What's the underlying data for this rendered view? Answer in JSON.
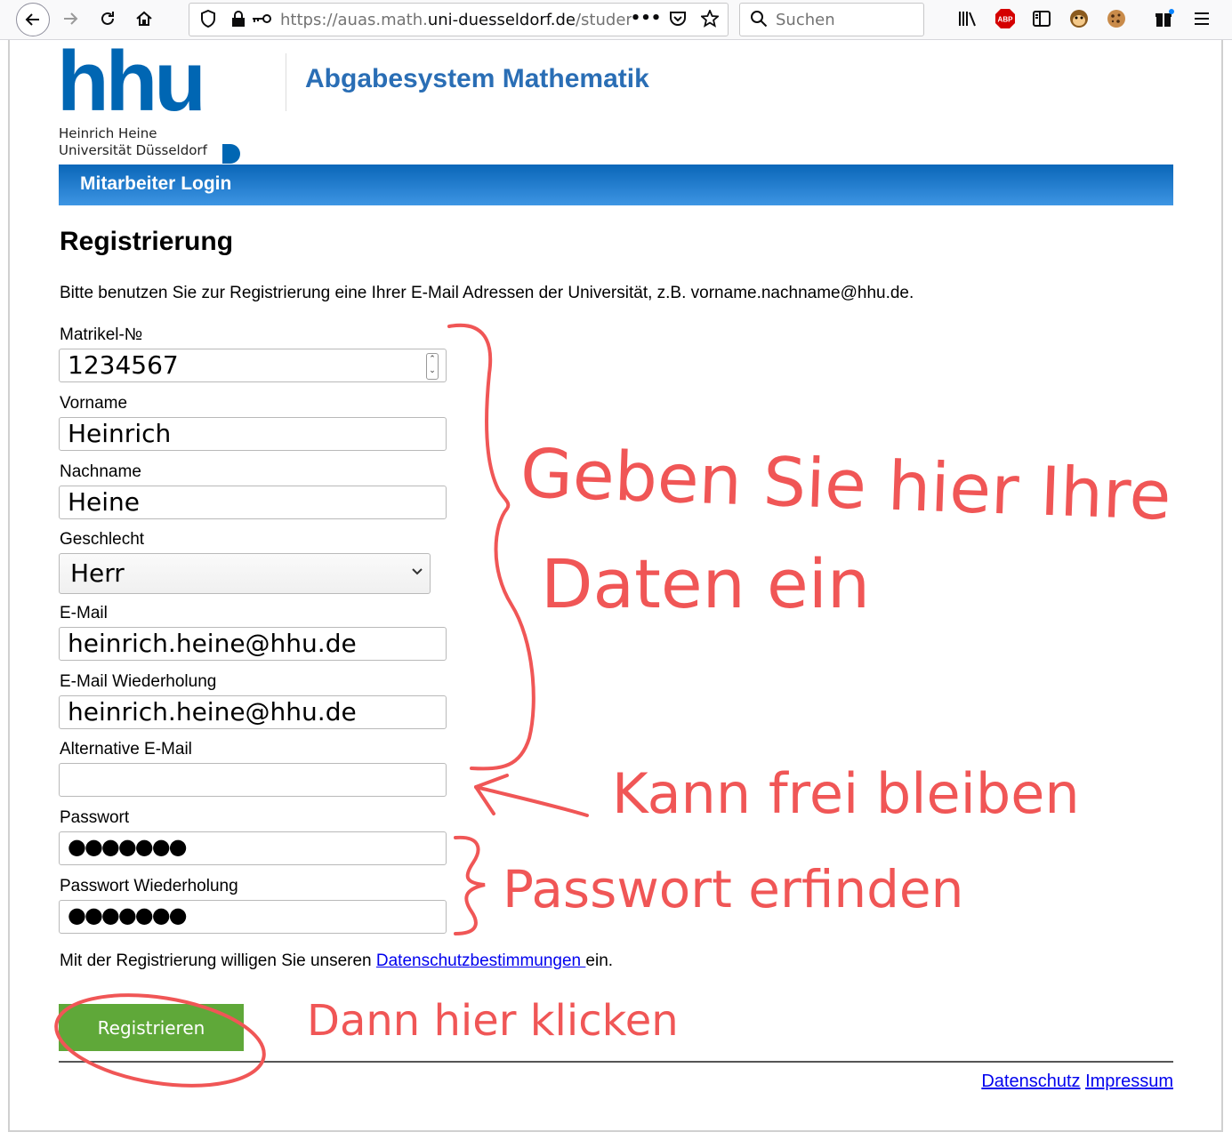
{
  "browser": {
    "url_prefix": "https://auas.math.",
    "url_domain": "uni-duesseldorf.de",
    "url_path": "/studen",
    "search_placeholder": "Suchen",
    "abp_label": "ABP",
    "icons": [
      "back-arrow-icon",
      "forward-arrow-icon",
      "reload-icon",
      "home-icon",
      "shield-icon",
      "lock-icon",
      "key-icon",
      "more-icon",
      "pocket-icon",
      "star-icon",
      "search-icon",
      "library-icon",
      "adblock-icon",
      "sidebar-icon",
      "monkey-icon",
      "cookie-icon",
      "gift-icon",
      "menu-icon"
    ]
  },
  "header": {
    "logo_main": "hhu",
    "logo_line1": "Heinrich Heine",
    "logo_line2": "Universität Düsseldorf",
    "site_title": "Abgabesystem Mathematik",
    "brand_color": "#0066b3",
    "nav_link": "Mitarbeiter Login"
  },
  "form": {
    "heading": "Registrierung",
    "intro": "Bitte benutzen Sie zur Registrierung eine Ihrer E-Mail Adressen der Universität, z.B. vorname.nachname@hhu.de.",
    "fields": {
      "matrikel": {
        "label": "Matrikel-№",
        "value": "1234567"
      },
      "vorname": {
        "label": "Vorname",
        "value": "Heinrich"
      },
      "nachname": {
        "label": "Nachname",
        "value": "Heine"
      },
      "geschlecht": {
        "label": "Geschlecht",
        "value": "Herr"
      },
      "email": {
        "label": "E-Mail",
        "value": "heinrich.heine@hhu.de"
      },
      "email_repeat": {
        "label": "E-Mail Wiederholung",
        "value": "heinrich.heine@hhu.de"
      },
      "alt_email": {
        "label": "Alternative E-Mail",
        "value": ""
      },
      "password": {
        "label": "Passwort",
        "value": "●●●●●●●"
      },
      "password_repeat": {
        "label": "Passwort Wiederholung",
        "value": "●●●●●●●"
      }
    },
    "consent_before": "Mit der Registrierung willigen Sie unseren ",
    "consent_link": "Datenschutzbestimmungen ",
    "consent_after": "ein.",
    "submit": "Registrieren",
    "submit_color": "#5fa839"
  },
  "footer": {
    "privacy": "Datenschutz",
    "imprint": "Impressum"
  },
  "annotations": {
    "color": "#f05656",
    "line1": "Geben Sie hier Ihre",
    "line2": "Daten ein",
    "optional": "Kann frei bleiben",
    "password": "Passwort erfinden",
    "click": "Dann hier klicken"
  }
}
